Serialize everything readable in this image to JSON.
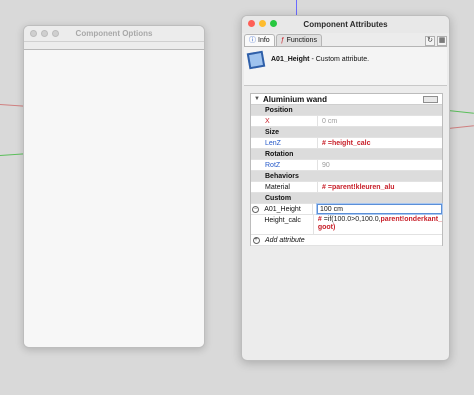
{
  "options_window": {
    "title": "Component Options"
  },
  "attr_window": {
    "title": "Component Attributes",
    "tabs": [
      {
        "label": "Info",
        "icon": "info-icon"
      },
      {
        "label": "Functions",
        "icon": "functions-icon"
      }
    ],
    "component": {
      "name": "A01_Height",
      "desc": "- Custom attribute."
    },
    "panel": {
      "title": "Aluminium wand",
      "sections": {
        "position": "Position",
        "size": "Size",
        "rotation": "Rotation",
        "behaviors": "Behaviors",
        "custom": "Custom"
      },
      "rows": {
        "x": {
          "label": "X",
          "value": "0 cm"
        },
        "lenz": {
          "label": "LenZ",
          "value": "=height_calc",
          "prefix": "#"
        },
        "rotz": {
          "label": "RotZ",
          "value": "90"
        },
        "material": {
          "label": "Material",
          "value": "=parent!kleuren_alu",
          "prefix": "#"
        },
        "a01_height": {
          "label": "A01_Height",
          "value": "100 cm"
        },
        "height_calc": {
          "label": "Height_calc",
          "prefix": "#",
          "v_line1a": "=if(100.0>0,100.0,",
          "v_line1b": "parent!onderkant_",
          "v_line2": "goot)"
        },
        "add": {
          "label": "Add attribute"
        }
      }
    }
  }
}
